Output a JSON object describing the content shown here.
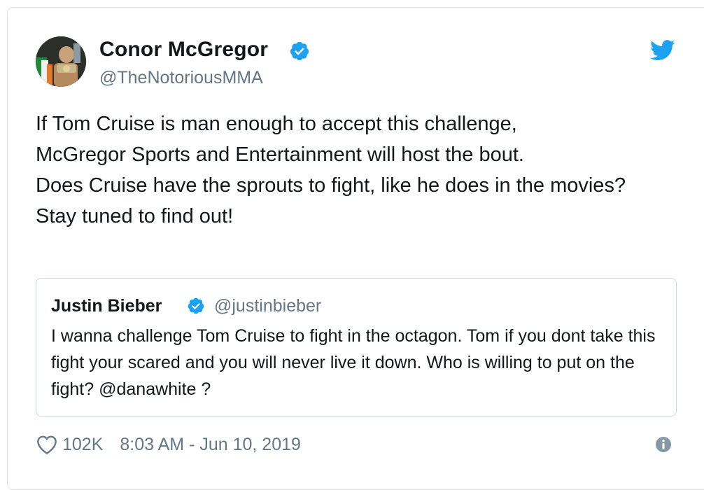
{
  "tweet": {
    "author": {
      "name": "Conor McGregor",
      "handle": "@TheNotoriousMMA",
      "verified": true
    },
    "text": "If Tom Cruise is man enough to accept this challenge,\nMcGregor Sports and Entertainment will host the bout.\nDoes Cruise have the sprouts to fight, like he does in the movies?\nStay tuned to find out!",
    "quoted": {
      "name": "Justin Bieber",
      "handle": "@justinbieber",
      "verified": true,
      "text": "I wanna challenge Tom Cruise to fight in the octagon. Tom if you dont take this fight your scared and you will never live it down. Who is willing to put on the fight? @danawhite ?"
    },
    "likes": "102K",
    "timestamp": "8:03 AM - Jun 10, 2019"
  },
  "icons": {
    "brand": "twitter-bird-icon",
    "verified": "verified-badge-icon",
    "like": "heart-icon",
    "info": "info-icon"
  },
  "colors": {
    "twitter_blue": "#1DA1F2",
    "text": "#14171A",
    "secondary": "#657786",
    "border": "#CCD6DD"
  }
}
